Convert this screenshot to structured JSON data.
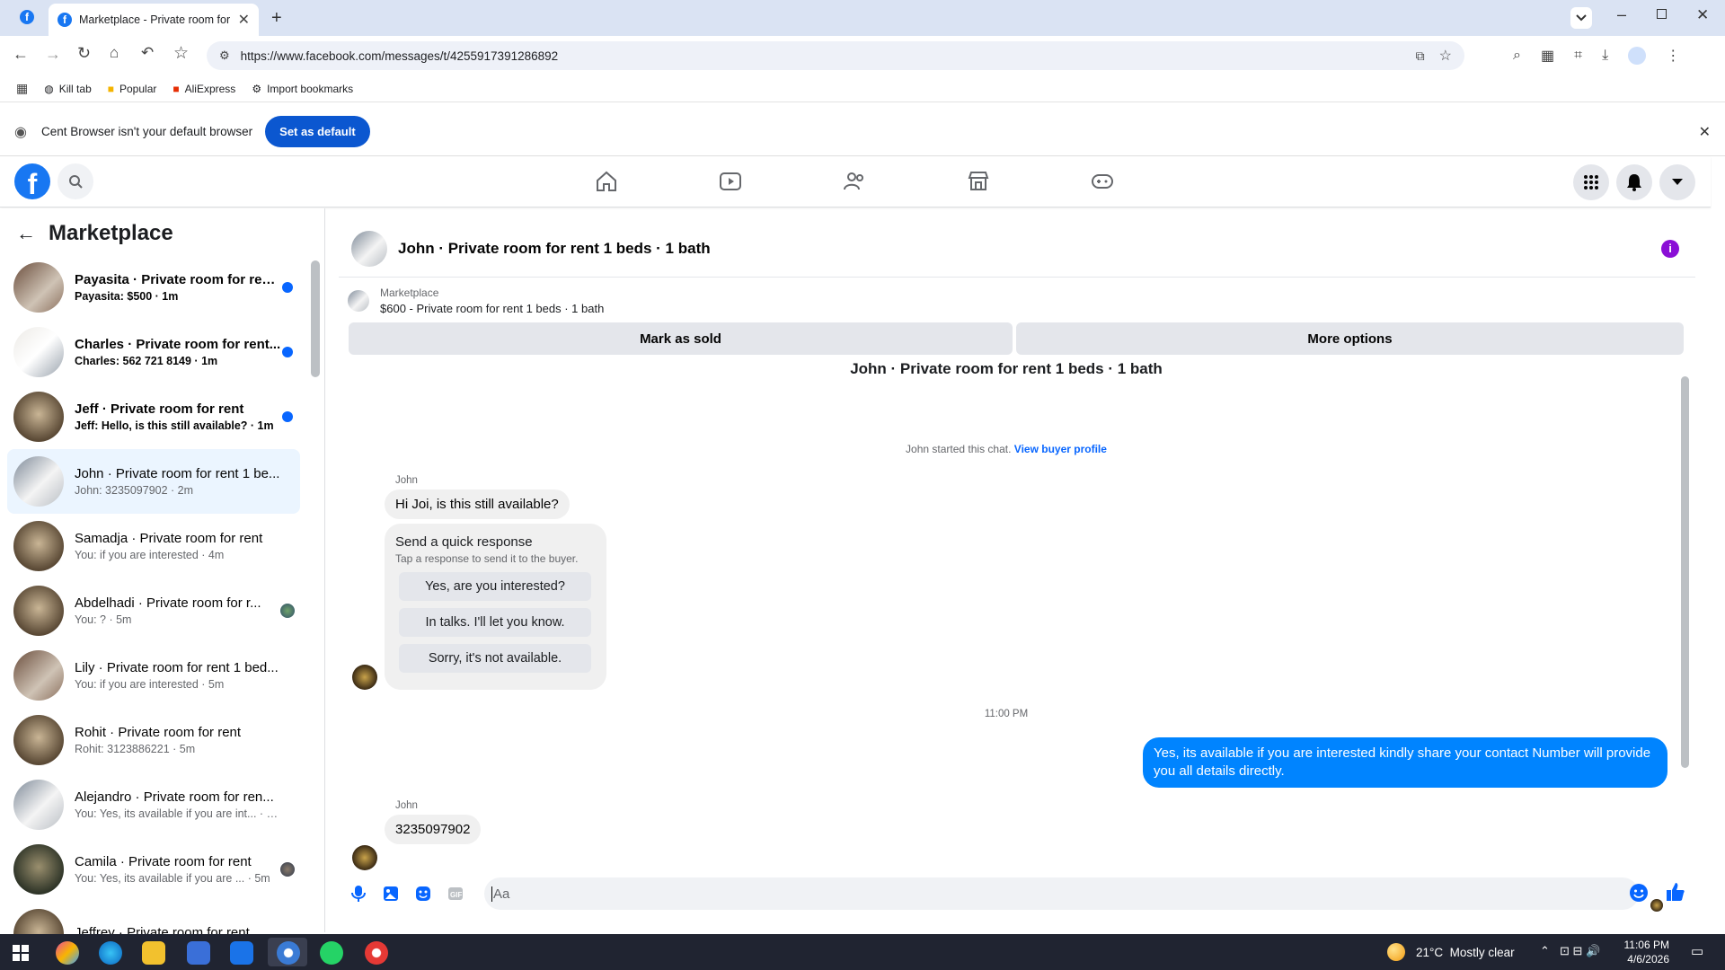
{
  "browser": {
    "tab_title": "Marketplace - Private room for",
    "url": "https://www.facebook.com/messages/t/4255917391286892",
    "bookmarks": [
      "Kill tab",
      "Popular",
      "AliExpress",
      "Import bookmarks"
    ],
    "infobar_text": "Cent Browser isn't your default browser",
    "set_default_label": "Set as default"
  },
  "left": {
    "title": "Marketplace",
    "conversations": [
      {
        "name": "Payasita · Private room for ren...",
        "preview": "Payasita: $500 · 1m",
        "unread": true
      },
      {
        "name": "Charles · Private room for rent...",
        "preview": "Charles: 562 721 8149 · 1m",
        "unread": true
      },
      {
        "name": "Jeff · Private room for rent",
        "preview": "Jeff: Hello, is this still available? · 1m",
        "unread": true
      },
      {
        "name": "John · Private room for rent 1 be...",
        "preview": "John: 3235097902 · 2m",
        "active": true
      },
      {
        "name": "Samadja · Private room for rent",
        "preview": "You: if you are interested · 4m"
      },
      {
        "name": "Abdelhadi · Private room for r...",
        "preview": "You: ? · 5m"
      },
      {
        "name": "Lily · Private room for rent 1 bed...",
        "preview": "You: if you are interested · 5m"
      },
      {
        "name": "Rohit · Private room for rent",
        "preview": "Rohit: 3123886221 · 5m"
      },
      {
        "name": "Alejandro · Private room for ren...",
        "preview": "You: Yes, its available if you are int... · 5m"
      },
      {
        "name": "Camila · Private room for rent",
        "preview": "You: Yes, its available if you are ... · 5m"
      },
      {
        "name": "Jeffrey · Private room for rent",
        "preview": ""
      }
    ]
  },
  "chat": {
    "header_title": "John · Private room for rent 1 beds · 1 bath",
    "listing_source": "Marketplace",
    "listing_price_title": "$600 - Private room for rent 1 beds · 1 bath",
    "mark_sold_label": "Mark as sold",
    "more_options_label": "More options",
    "thread_title": "John · Private room for rent 1 beds · 1 bath",
    "started_text": "John started this chat.",
    "view_profile_label": "View buyer profile",
    "sender_name": "John",
    "msg1": "Hi Joi, is this still available?",
    "quick_title": "Send a quick response",
    "quick_sub": "Tap a response to send it to the buyer.",
    "quick_responses": [
      "Yes, are you interested?",
      "In talks. I'll let you know.",
      "Sorry, it's not available."
    ],
    "time_divider": "11:00 PM",
    "my_msg": "Yes, its available if you are interested kindly share your contact Number will provide you all details directly.",
    "sender_name2": "John",
    "msg2": "3235097902",
    "composer_placeholder": "Aa"
  },
  "taskbar": {
    "weather": "21°C  Mostly clear",
    "time": "11:06 PM",
    "date": "4/6/2026"
  },
  "colors": {
    "accent": "#0866ff",
    "bubble_me": "#0084ff",
    "fb_blue": "#1877f2"
  }
}
